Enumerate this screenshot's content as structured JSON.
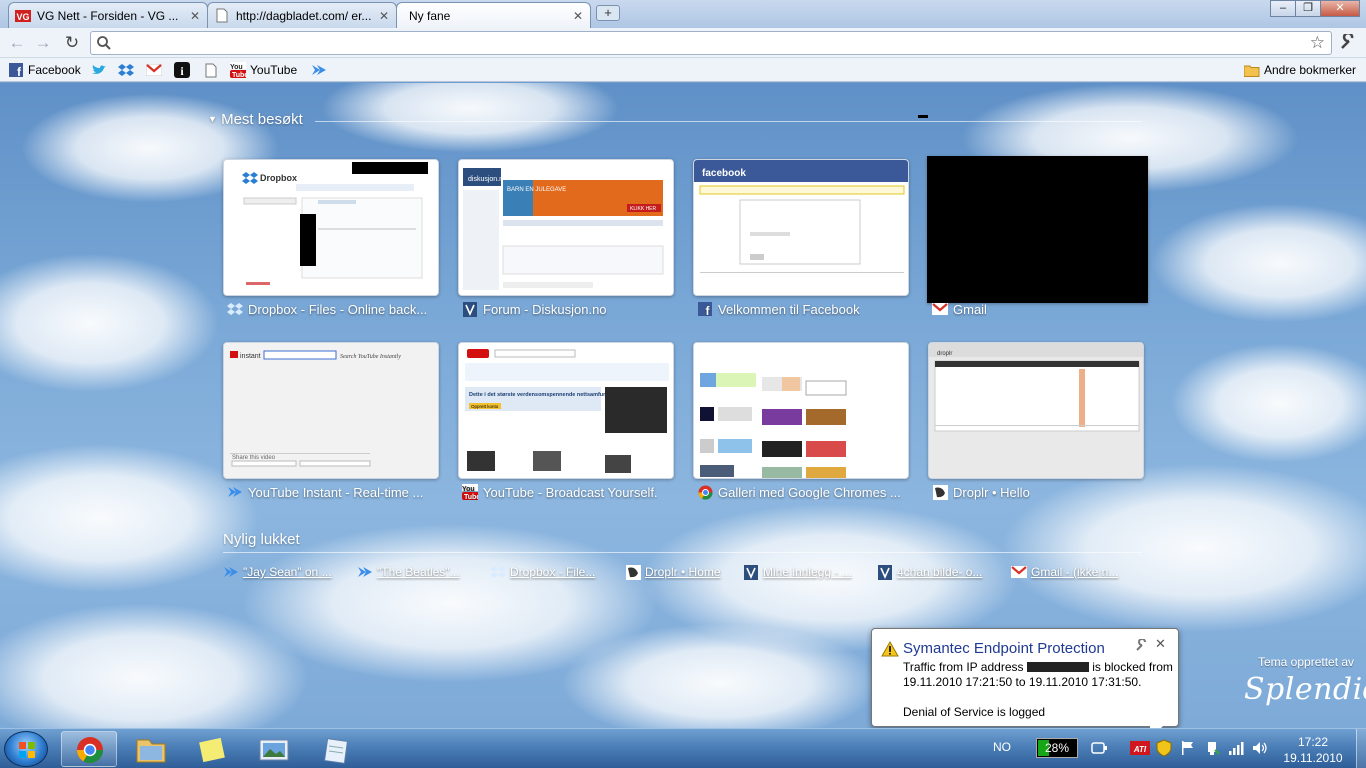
{
  "tabs": [
    {
      "title": "VG Nett - Forsiden - VG ...",
      "icon": "vg-icon"
    },
    {
      "title": "http://dagbladet.com/ er...",
      "icon": "page-icon"
    },
    {
      "title": "Ny fane",
      "icon": "none"
    }
  ],
  "window_controls": {
    "minimize": "–",
    "maximize": "❐",
    "close": "✕"
  },
  "omnibox": {
    "value": "",
    "placeholder": ""
  },
  "bookmarks": {
    "facebook": "Facebook",
    "youtube": "YouTube",
    "other": "Andre bokmerker"
  },
  "most_visited": {
    "title": "Mest besøkt",
    "items": [
      {
        "caption": "Dropbox - Files - Online back...",
        "icon": "dropbox-icon"
      },
      {
        "caption": "Forum - Diskusjon.no",
        "icon": "diskusjon-icon"
      },
      {
        "caption": "Velkommen til Facebook",
        "icon": "facebook-icon"
      },
      {
        "caption": "Gmail",
        "icon": "gmail-icon"
      },
      {
        "caption": "YouTube Instant - Real-time ...",
        "icon": "youtube-instant-icon"
      },
      {
        "caption": "YouTube - Broadcast Yourself.",
        "icon": "youtube-icon"
      },
      {
        "caption": "Galleri med Google Chromes ...",
        "icon": "chrome-icon"
      },
      {
        "caption": "Droplr • Hello",
        "icon": "droplr-icon"
      }
    ]
  },
  "thumb_text": {
    "dropbox_logo": "Dropbox",
    "diskusjon_logo": "diskusjon.no",
    "diskusjon_ad": "BARN EN JULEGAVE",
    "diskusjon_btn": "KLIKK HER",
    "facebook_logo": "facebook",
    "yt_instant_logo": "instant",
    "yt_instant_hint": "Search YouTube Instantly",
    "yt_instant_share": "Share this video",
    "yt_banner": "Dette i det største verdensomspennende nettsamfunnet for videodeling!",
    "yt_signup": "Opprett konto",
    "droplr_logo": "droplr"
  },
  "recently_closed": {
    "title": "Nylig lukket",
    "items": [
      {
        "label": "\"Jay Sean\" on ...",
        "icon": "youtube-instant-icon"
      },
      {
        "label": "\"The Beatles\"...",
        "icon": "youtube-instant-icon"
      },
      {
        "label": "Dropbox - File...",
        "icon": "dropbox-icon"
      },
      {
        "label": "Droplr • Home",
        "icon": "droplr-icon"
      },
      {
        "label": "Mine innlegg - ...",
        "icon": "diskusjon-icon"
      },
      {
        "label": "4chan bilde- o...",
        "icon": "diskusjon-icon"
      },
      {
        "label": "Gmail - (ikke n...",
        "icon": "gmail-icon"
      }
    ]
  },
  "theme": {
    "credit": "Tema opprettet av",
    "name": "Splendid"
  },
  "notification": {
    "title": "Symantec Endpoint Protection",
    "line1_prefix": "Traffic from IP address",
    "line1_suffix": "is blocked from",
    "line2": "19.11.2010 17:21:50 to 19.11.2010 17:31:50.",
    "line3": "Denial of Service is logged",
    "close": "✕"
  },
  "taskbar": {
    "language": "NO",
    "battery_text": "28%",
    "battery_level": 0.28,
    "time": "17:22",
    "date": "19.11.2010"
  }
}
